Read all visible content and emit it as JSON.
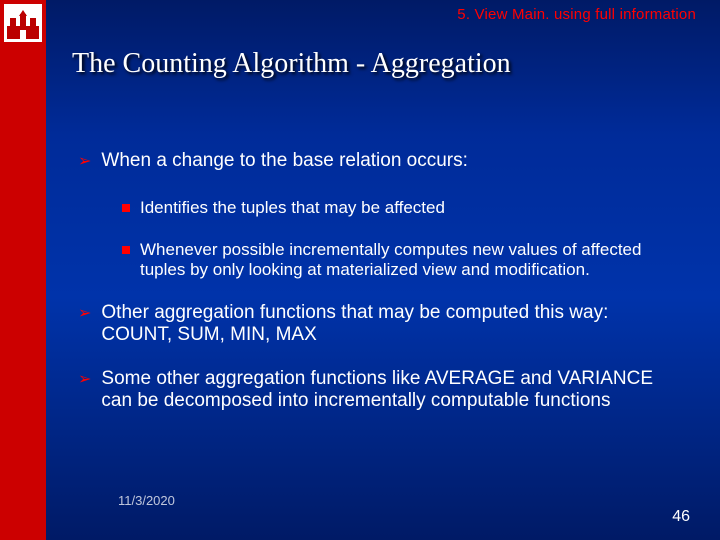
{
  "breadcrumb": "5. View Main. using full information",
  "title": "The Counting Algorithm - Aggregation",
  "bullets": [
    {
      "text": "When a change to the base relation occurs:",
      "sub": [
        "Identifies the tuples that may be affected",
        "Whenever possible incrementally computes new values of affected tuples by only looking at materialized view and modification."
      ]
    },
    {
      "text": "Other aggregation functions that may be computed this way: COUNT, SUM, MIN, MAX",
      "sub": []
    },
    {
      "text": "Some other aggregation functions like AVERAGE and VARIANCE can be decomposed into incrementally computable functions",
      "sub": []
    }
  ],
  "footer": {
    "date": "11/3/2020",
    "page": "46"
  },
  "colors": {
    "accent_red": "#cc0000",
    "bullet_red": "#ff0000",
    "bg_blue_top": "#001a66",
    "bg_blue_mid": "#0033aa"
  }
}
